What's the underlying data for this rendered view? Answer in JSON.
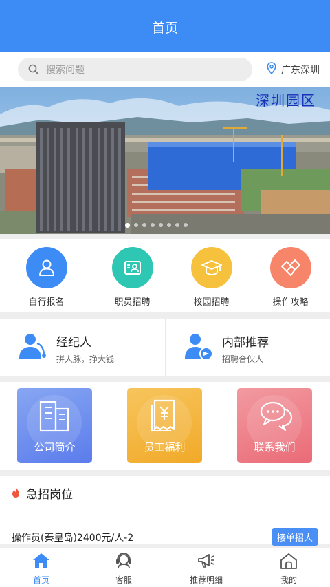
{
  "header": {
    "title": "首页"
  },
  "search": {
    "placeholder": "搜索问题",
    "icon": "search-icon"
  },
  "location": {
    "label": "广东深圳",
    "icon": "location-pin-icon"
  },
  "banner": {
    "caption": "深圳园区",
    "slide_count": 8,
    "active_index": 0
  },
  "quick_actions": [
    {
      "label": "自行报名",
      "icon": "user-icon",
      "color": "#3d8bf5"
    },
    {
      "label": "职员招聘",
      "icon": "id-card-icon",
      "color": "#2ec7b4"
    },
    {
      "label": "校园招聘",
      "icon": "graduation-cap-icon",
      "color": "#f6c23e"
    },
    {
      "label": "操作攻略",
      "icon": "handshake-icon",
      "color": "#f7856a"
    }
  ],
  "agents": [
    {
      "title": "经纪人",
      "subtitle": "拼人脉，挣大钱",
      "icon": "agent-icon"
    },
    {
      "title": "内部推荐",
      "subtitle": "招聘合伙人",
      "icon": "referral-icon"
    }
  ],
  "features": [
    {
      "label": "公司简介",
      "icon": "building-icon",
      "color": "#6f8ff0"
    },
    {
      "label": "员工福利",
      "icon": "yuan-receipt-icon",
      "color": "#f3b63c"
    },
    {
      "label": "联系我们",
      "icon": "chat-bubbles-icon",
      "color": "#ee7f89"
    }
  ],
  "urgent": {
    "title": "急招岗位",
    "icon": "flame-icon"
  },
  "jobs": [
    {
      "title": "操作员(秦皇岛)2400元/人-2",
      "button": "接单招人"
    }
  ],
  "tabbar": [
    {
      "label": "首页",
      "icon": "home-icon",
      "active": true
    },
    {
      "label": "客服",
      "icon": "headset-icon",
      "active": false
    },
    {
      "label": "推荐明细",
      "icon": "megaphone-icon",
      "active": false
    },
    {
      "label": "我的",
      "icon": "profile-home-icon",
      "active": false
    }
  ],
  "colors": {
    "primary": "#3d8bf5",
    "background": "#eeeeee"
  }
}
